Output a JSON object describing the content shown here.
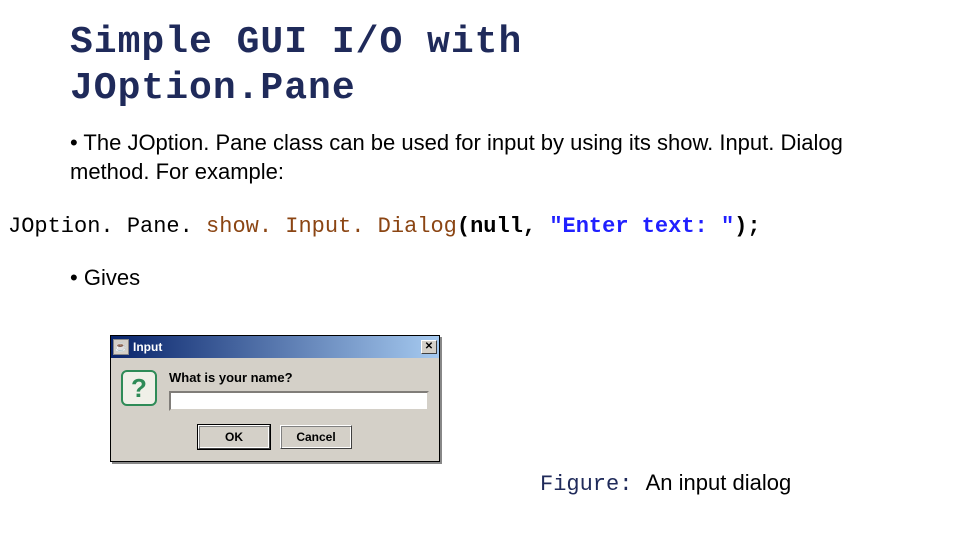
{
  "title_line1": "Simple GUI I/O with",
  "title_line2": "JOption.Pane",
  "bullet1": "The JOption. Pane class can be used for input by using its show. Input. Dialog method. For example:",
  "code": {
    "part1": "JOption. Pane. ",
    "part2": "show. Input. Dialog",
    "part3": "(",
    "part4": "null",
    "part5": ", ",
    "part6": "\"Enter text: \"",
    "part7": ");"
  },
  "bullet2": "Gives",
  "dialog": {
    "title": "Input",
    "close": "✕",
    "icon_glyph": "?",
    "prompt": "What is your name?",
    "input_value": "",
    "ok": "OK",
    "cancel": "Cancel"
  },
  "caption": {
    "label": "Figure: ",
    "text": "An input dialog"
  }
}
